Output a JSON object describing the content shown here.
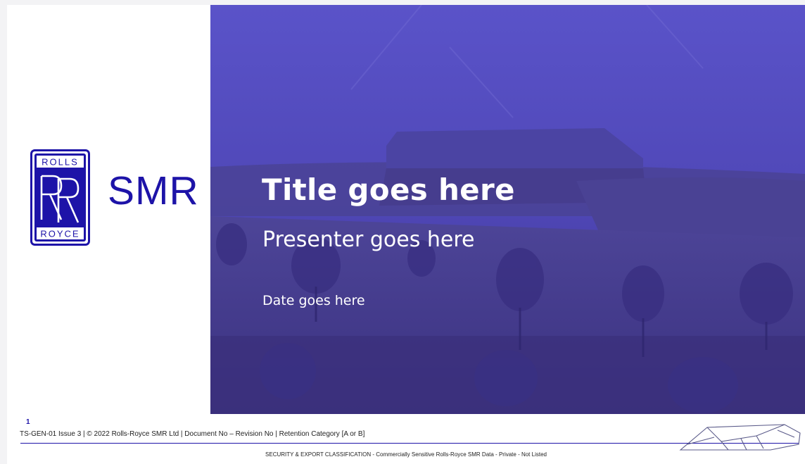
{
  "brand": {
    "logo_top_text": "ROLLS",
    "logo_bottom_text": "ROYCE",
    "logo_monogram": "RR",
    "name": "SMR",
    "color": "#1d13a8"
  },
  "hero": {
    "title": "Title goes here",
    "presenter": "Presenter goes here",
    "date": "Date goes here",
    "overlay_color": "#4a3fc0"
  },
  "footer": {
    "page_number": "1",
    "document_line": "TS-GEN-01 Issue 3 | © 2022 Rolls-Royce SMR Ltd | Document No – Revision No | Retention Category [A or B]",
    "security_classification": "SECURITY & EXPORT CLASSIFICATION - Commercially Sensitive Rolls-Royce SMR Data - Private - Not Listed"
  }
}
